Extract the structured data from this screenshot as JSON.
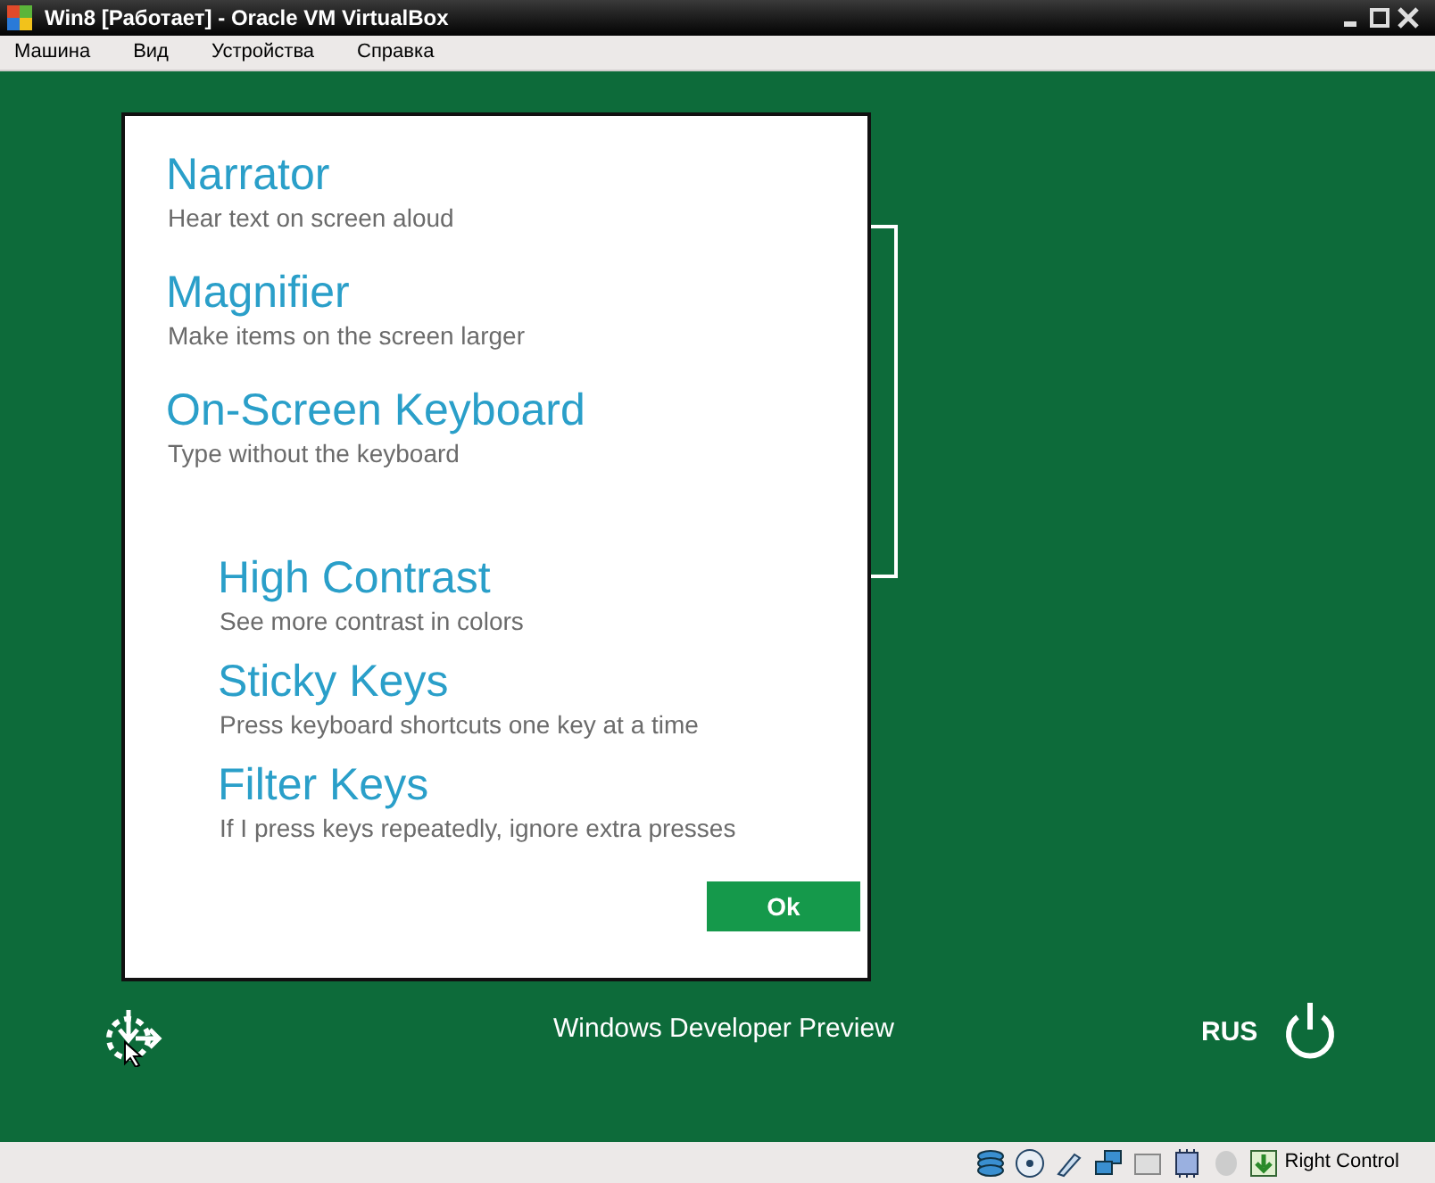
{
  "window": {
    "title": "Win8 [Работает] - Oracle VM VirtualBox"
  },
  "menu": [
    "Машина",
    "Вид",
    "Устройства",
    "Справка"
  ],
  "dialog": {
    "options": [
      {
        "title": "Narrator",
        "description": "Hear text on screen aloud"
      },
      {
        "title": "Magnifier",
        "description": "Make items on the screen larger"
      },
      {
        "title": "On-Screen Keyboard",
        "description": "Type without the keyboard"
      }
    ],
    "more_options": [
      {
        "title": "High Contrast",
        "description": "See more contrast in colors"
      },
      {
        "title": "Sticky Keys",
        "description": "Press keyboard shortcuts one key at a time"
      },
      {
        "title": "Filter Keys",
        "description": "If I press keys repeatedly, ignore extra presses"
      }
    ],
    "ok_button": "Ok"
  },
  "footer": {
    "caption": "Windows Developer Preview",
    "language": "RUS"
  },
  "status_bar": {
    "host_key": "Right Control"
  }
}
